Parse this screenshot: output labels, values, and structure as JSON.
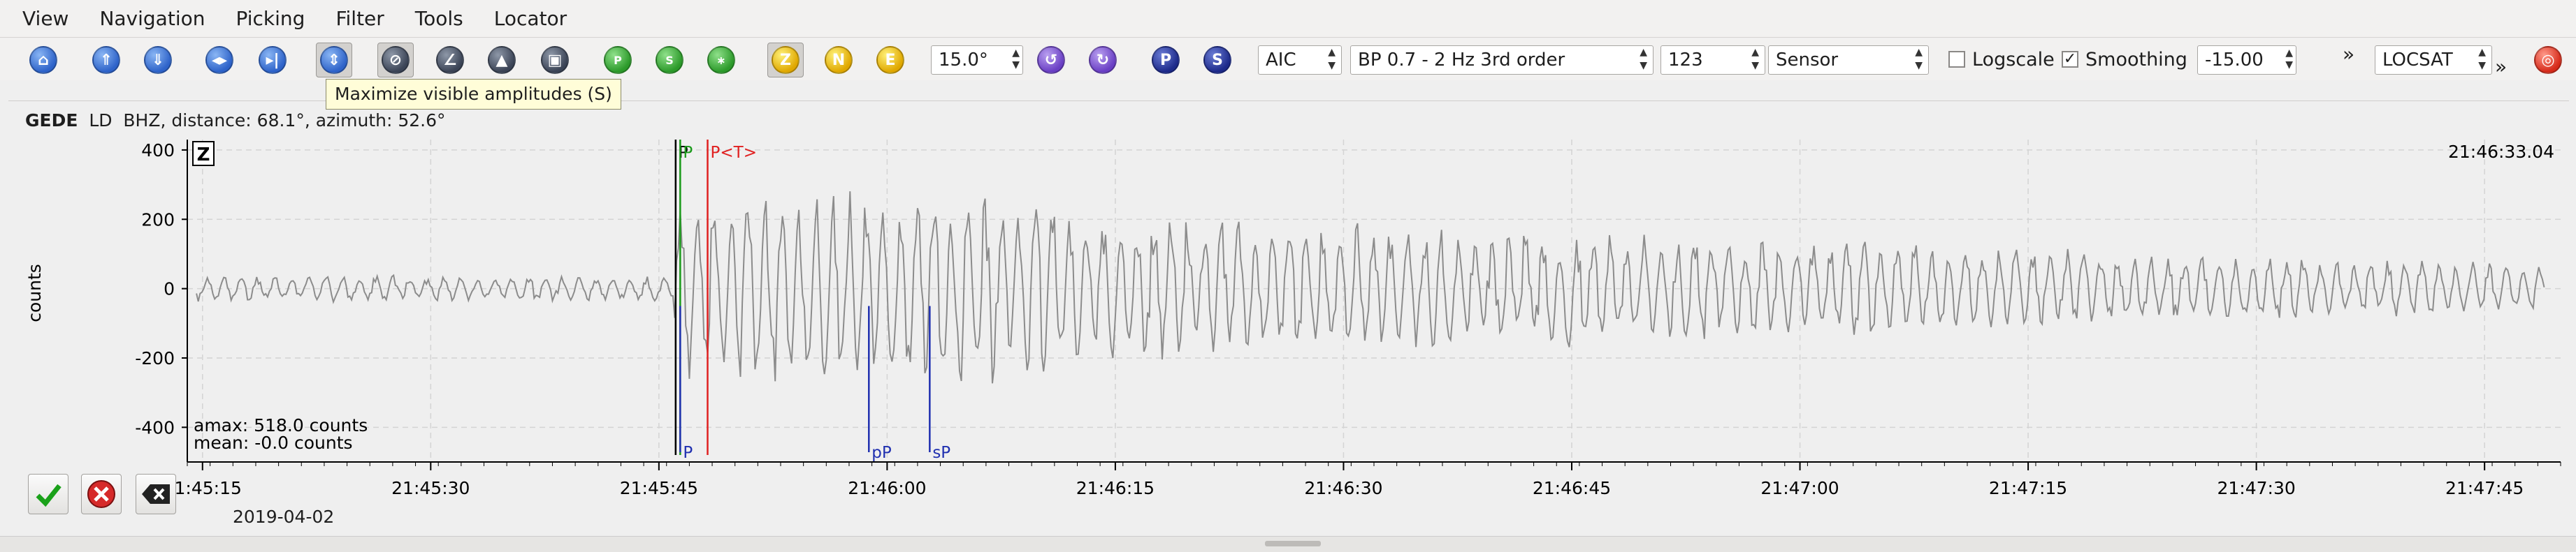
{
  "menu": [
    "View",
    "Navigation",
    "Picking",
    "Filter",
    "Tools",
    "Locator"
  ],
  "toolbar": {
    "slowness_value": "15.0°",
    "picker_method": "AIC",
    "filter": "BP 0.7 - 2 Hz  3rd order",
    "filter_param": "123",
    "sensor_unit": "Sensor",
    "logscale_label": "Logscale",
    "logscale_checked": false,
    "smoothing_label": "Smoothing",
    "smoothing_checked": true,
    "smoothing_check_mark": "✓",
    "smoothing_value": "-15.00",
    "locator": "LOCSAT",
    "overflow_glyph_1": "»",
    "overflow_glyph_2": "»",
    "comp_z": "Z",
    "comp_n": "N",
    "comp_e": "E",
    "phase_p": "P",
    "phase_s": "S",
    "icons": [
      "home-icon",
      "scroll-up-icon",
      "scroll-down-icon",
      "back-icon",
      "last-icon",
      "maximize-amplitudes-icon",
      "pick-icon",
      "align-icon",
      "zoom-icon",
      "save-icon",
      "show-p-icon",
      "show-s-icon",
      "show-all-icon",
      "comp-z",
      "comp-n",
      "comp-e",
      "rotate-left-icon",
      "rotate-right-icon",
      "phase-p",
      "phase-s",
      "target-icon"
    ]
  },
  "tooltip": "Maximize visible amplitudes (S)",
  "trace": {
    "station": "GEDE",
    "rest": "  LD  BHZ, distance: 68.1°, azimuth: 52.6°",
    "component_badge": "Z",
    "time_label": "21:46:33.04",
    "ylabel": "counts",
    "amax": "amax: 518.0 counts",
    "mean": "mean: -0.0 counts",
    "date": "2019-04-02",
    "colors": {
      "trace": "#8c8c8c",
      "pick_black": "#000000",
      "pick_green": "#1a9a1a",
      "pick_red": "#e02020",
      "arrival_blue": "#2030b0"
    }
  },
  "chart_data": {
    "type": "line",
    "title": "",
    "xlabel": "",
    "ylabel": "counts",
    "xlim": [
      "21:45:14",
      "21:47:50"
    ],
    "ylim": [
      -500,
      430
    ],
    "yticks": [
      400,
      200,
      0,
      -200,
      -400
    ],
    "xticks": [
      "21:45:15",
      "21:45:30",
      "21:45:45",
      "21:46:00",
      "21:46:15",
      "21:46:30",
      "21:46:45",
      "21:47:00",
      "21:47:15",
      "21:47:30",
      "21:47:45"
    ],
    "grid": true,
    "picks": [
      {
        "label": "P",
        "time_s": 32.1,
        "color": "#000000",
        "position": "top"
      },
      {
        "label": "P",
        "time_s": 32.4,
        "color": "#1a9a1a",
        "position": "top"
      },
      {
        "label": "P<T>",
        "time_s": 34.2,
        "color": "#e02020",
        "position": "top"
      },
      {
        "label": "P",
        "time_s": 32.4,
        "color": "#2030b0",
        "position": "bottom"
      },
      {
        "label": "pP",
        "time_s": 44.8,
        "color": "#2030b0",
        "position": "bottom"
      },
      {
        "label": "sP",
        "time_s": 48.8,
        "color": "#2030b0",
        "position": "bottom"
      }
    ],
    "series": [
      {
        "amplitude_pre": 35,
        "amplitude_event": 260,
        "onset_s": 32.0
      }
    ]
  },
  "buttons": {
    "accept": "accept",
    "reject": "reject",
    "delete": "delete"
  }
}
